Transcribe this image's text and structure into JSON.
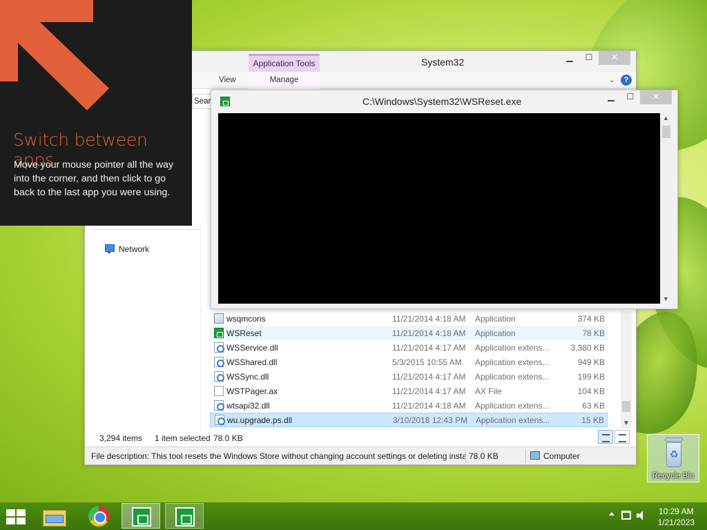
{
  "explorer": {
    "title": "System32",
    "contextual_tab": "Application Tools",
    "ribbon_tabs": {
      "partial": "re",
      "view": "View",
      "manage": "Manage"
    },
    "search_partial": "Searc",
    "nav": {
      "network": "Network"
    },
    "files": [
      {
        "name": "wsqmcons",
        "date": "11/21/2014 4:18 AM",
        "type": "Application",
        "size": "374 KB",
        "icon": "app-icon"
      },
      {
        "name": "WSReset",
        "date": "11/21/2014 4:18 AM",
        "type": "Application",
        "size": "78 KB",
        "icon": "store-icon"
      },
      {
        "name": "WSService.dll",
        "date": "11/21/2014 4:17 AM",
        "type": "Application extens...",
        "size": "3,380 KB",
        "icon": "dll-icon"
      },
      {
        "name": "WSShared.dll",
        "date": "5/3/2015 10:55 AM",
        "type": "Application extens...",
        "size": "949 KB",
        "icon": "dll-icon"
      },
      {
        "name": "WSSync.dll",
        "date": "11/21/2014 4:17 AM",
        "type": "Application extens...",
        "size": "199 KB",
        "icon": "dll-icon"
      },
      {
        "name": "WSTPager.ax",
        "date": "11/21/2014 4:17 AM",
        "type": "AX File",
        "size": "104 KB",
        "icon": "file-icon"
      },
      {
        "name": "wtsapi32.dll",
        "date": "11/21/2014 4:18 AM",
        "type": "Application extens...",
        "size": "63 KB",
        "icon": "dll-icon"
      },
      {
        "name": "wu.upgrade.ps.dll",
        "date": "3/10/2018 12:43 PM",
        "type": "Application extens...",
        "size": "15 KB",
        "icon": "dll-icon"
      }
    ],
    "status": {
      "items": "3,294 items",
      "selected": "1 item selected",
      "selected_size": "78.0 KB",
      "description": "File description: This tool resets the Windows Store without changing account settings or deleting insta",
      "size": "78.0 KB",
      "location": "Computer"
    }
  },
  "console": {
    "title": "C:\\Windows\\System32\\WSReset.exe"
  },
  "tip": {
    "title": "Switch between apps",
    "body": "Move your mouse pointer all the way into the corner, and then click to go back to the last app you were using."
  },
  "desktop": {
    "recycle_bin": "Recycle Bin"
  },
  "taskbar": {
    "time": "10:29 AM",
    "date": "1/21/2023"
  },
  "colors": {
    "tip_accent": "#e2603a",
    "tip_bg": "#1c1c1c",
    "taskbar": "#3b7408"
  }
}
